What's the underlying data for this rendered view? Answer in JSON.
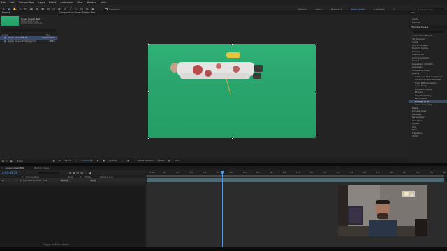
{
  "menu": [
    "File",
    "Edit",
    "Composition",
    "Layer",
    "Effect",
    "Animation",
    "View",
    "Window",
    "Help"
  ],
  "toolbar": {
    "snapping_label": "Snapping",
    "workspaces": [
      "Default",
      "Learn",
      "Standard",
      "Small Screen",
      "Libraries"
    ],
    "search_placeholder": "Search Help"
  },
  "project": {
    "tab": "Project",
    "comp_name": "Green Screen Test",
    "comp_info": "1920 x 1080 (1.00)\nΔ 0:00:10:00, 25.00 fps",
    "items": [
      {
        "name": "Green Screen Test",
        "type": "Composition",
        "selected": true
      },
      {
        "name": "Green Screen Footage.mp4",
        "type": "MPEG",
        "selected": false
      }
    ],
    "bpc": "8 bpc"
  },
  "composition": {
    "tab": "Composition Green Screen Test",
    "zoom": "39.6%",
    "timecode": "0:00:03:18",
    "resolution": "Quarter",
    "camera": "Active Camera",
    "view": "1 View",
    "offset": "+0.0"
  },
  "right_panel": {
    "tabs": [
      "Info",
      "Audio",
      "Preview",
      "Effects & Presets",
      "Align",
      "Libraries",
      "Character",
      "Paragraph",
      "Tracker",
      "Content-Aware Fill"
    ],
    "search_placeholder": "",
    "effects_title": "Effects & Presets",
    "fx": [
      {
        "label": "* Animation Presets",
        "indent": false,
        "selected": false
      },
      {
        "label": "3D Channel",
        "indent": false,
        "selected": false
      },
      {
        "label": "Audio",
        "indent": false,
        "selected": false
      },
      {
        "label": "Blur & Sharpen",
        "indent": false,
        "selected": false
      },
      {
        "label": "Boris FX Mocha",
        "indent": false,
        "selected": false
      },
      {
        "label": "Channel",
        "indent": false,
        "selected": false
      },
      {
        "label": "CINEMA 4D",
        "indent": false,
        "selected": false
      },
      {
        "label": "Color Correction",
        "indent": false,
        "selected": false
      },
      {
        "label": "Distort",
        "indent": false,
        "selected": false
      },
      {
        "label": "Expression Controls",
        "indent": false,
        "selected": false
      },
      {
        "label": "Generate",
        "indent": false,
        "selected": false
      },
      {
        "label": "Immersive Video",
        "indent": false,
        "selected": false
      },
      {
        "label": "Keying",
        "indent": false,
        "selected": false
      },
      {
        "label": "Advanced Spill Suppressor",
        "indent": true,
        "selected": false
      },
      {
        "label": "CC Simple Wire Removal",
        "indent": true,
        "selected": false
      },
      {
        "label": "Color Difference Key",
        "indent": true,
        "selected": false
      },
      {
        "label": "Color Range",
        "indent": true,
        "selected": false
      },
      {
        "label": "Difference Matte",
        "indent": true,
        "selected": false
      },
      {
        "label": "Extract",
        "indent": true,
        "selected": false
      },
      {
        "label": "Inner/Outer Key",
        "indent": true,
        "selected": false
      },
      {
        "label": "Key Cleaner",
        "indent": true,
        "selected": false
      },
      {
        "label": "Keylight (1.2)",
        "indent": true,
        "selected": true
      },
      {
        "label": "Linear Color Key",
        "indent": true,
        "selected": false
      },
      {
        "label": "Matte",
        "indent": false,
        "selected": false
      },
      {
        "label": "Noise & Grain",
        "indent": false,
        "selected": false
      },
      {
        "label": "Obsolete",
        "indent": false,
        "selected": false
      },
      {
        "label": "Perspective",
        "indent": false,
        "selected": false
      },
      {
        "label": "Simulation",
        "indent": false,
        "selected": false
      },
      {
        "label": "Stylize",
        "indent": false,
        "selected": false
      },
      {
        "label": "Text",
        "indent": false,
        "selected": false
      },
      {
        "label": "Time",
        "indent": false,
        "selected": false
      },
      {
        "label": "Transition",
        "indent": false,
        "selected": false
      },
      {
        "label": "Utility",
        "indent": false,
        "selected": false
      }
    ],
    "lower_tabs": [
      "Character",
      "Align",
      "Paragraph",
      "Tracker",
      "Content-Aware Fill"
    ]
  },
  "timeline": {
    "tabs": [
      "Green Screen Test",
      "Render Queue"
    ],
    "timecode": "0:00:03:18",
    "columns": [
      "#",
      "Source Name",
      "Mode",
      "T",
      "TrkMat",
      "Parent & Link"
    ],
    "layer": {
      "index": "1",
      "name": "Green Screen Foot...mp4",
      "mode": "Normal",
      "parent": "None"
    },
    "ticks": [
      "0:00s",
      "01s",
      "02s",
      "03s",
      "04s",
      "05s",
      "06s",
      "07s",
      "08s",
      "09s",
      "10s",
      "11s",
      "12s",
      "13s",
      "14s",
      "15s",
      "16s",
      "17s",
      "18s",
      "19s",
      "20s",
      "21s",
      "22s"
    ],
    "toggle_label": "Toggle Switches / Modes"
  },
  "colors": {
    "accent": "#4d9df0",
    "green_screen": "#2aa56d",
    "playhead": "#4d9df0",
    "layer_bar": "#4f6a73"
  }
}
